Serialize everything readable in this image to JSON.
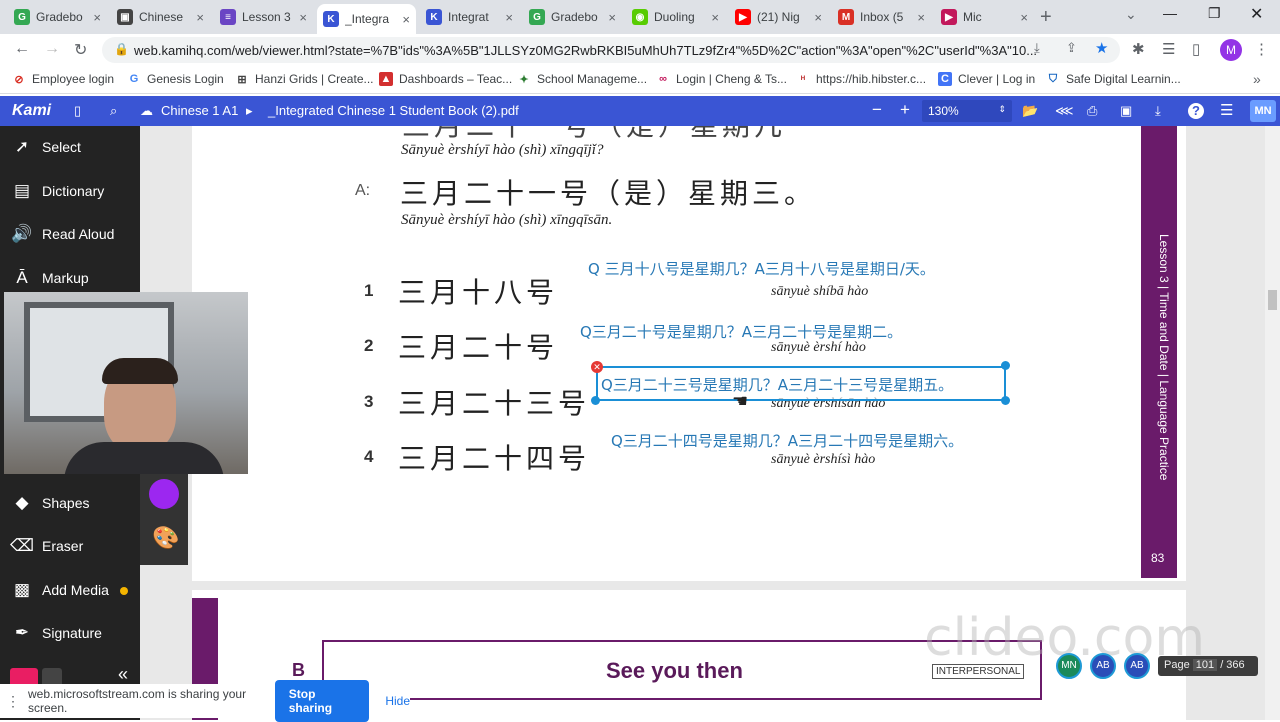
{
  "tabs": [
    {
      "label": "Gradebo",
      "fav": "G",
      "color": "#34a853"
    },
    {
      "label": "Chinese",
      "fav": "▣",
      "color": "#444"
    },
    {
      "label": "Lesson 3",
      "fav": "≡",
      "color": "#6a45c4"
    },
    {
      "label": "_Integra",
      "fav": "K",
      "color": "#3a55d4"
    },
    {
      "label": "Integrat",
      "fav": "K",
      "color": "#3a55d4"
    },
    {
      "label": "Gradebo",
      "fav": "G",
      "color": "#34a853"
    },
    {
      "label": "Duoling",
      "fav": "◉",
      "color": "#58cc02"
    },
    {
      "label": "(21) Nig",
      "fav": "▶",
      "color": "#ff0000"
    },
    {
      "label": "Inbox (5",
      "fav": "M",
      "color": "#d93025"
    },
    {
      "label": "Mic",
      "fav": "▶",
      "color": "#c2185b"
    }
  ],
  "url": "web.kamihq.com/web/viewer.html?state=%7B\"ids\"%3A%5B\"1JLLSYz0MG2RwbRKBI5uMhUh7TLz9fZr4\"%5D%2C\"action\"%3A\"open\"%2C\"userId\"%3A\"10...",
  "profile_initial": "M",
  "bookmarks": [
    "Employee login",
    "Genesis Login",
    "Hanzi Grids | Create...",
    "Dashboards – Teac...",
    "School Manageme...",
    "Login | Cheng & Ts...",
    "https://hib.hibster.c...",
    "Clever | Log in",
    "Safe Digital Learnin..."
  ],
  "kami": {
    "logo": "Kami",
    "breadcrumb_folder": "Chinese 1 A1",
    "filename": "_Integrated Chinese 1 Student Book (2).pdf",
    "zoom": "130%",
    "user_initials": "MN"
  },
  "sidebar": {
    "items": [
      "Select",
      "Dictionary",
      "Read Aloud",
      "Markup",
      "Shapes",
      "Eraser",
      "Add Media",
      "Signature"
    ]
  },
  "page": {
    "top_pinyin": "Sānyuè èrshíyī hào (shì) xīngqījǐ?",
    "a_label": "A:",
    "a_hanzi": "三月二十一号（是）星期三。",
    "a_pinyin": "Sānyuè èrshíyī hào (shì) xīngqīsān.",
    "items": [
      {
        "num": "1",
        "hanzi": "三月十八号",
        "pinyin": "sānyuè shíbā hào",
        "answer": "Q 三月十八号是星期几？A三月十八号是星期日/天。"
      },
      {
        "num": "2",
        "hanzi": "三月二十号",
        "pinyin": "sānyuè èrshí hào",
        "answer": "Q三月二十号是星期几？A三月二十号是星期二。"
      },
      {
        "num": "3",
        "hanzi": "三月二十三号",
        "pinyin": "sānyuè èrshísān hào",
        "answer": "Q三月二十三号是星期几？A三月二十三号是星期五。"
      },
      {
        "num": "4",
        "hanzi": "三月二十四号",
        "pinyin": "sānyuè èrshísì hào",
        "answer": "Q三月二十四号是星期几？A三月二十四号是星期六。"
      }
    ],
    "side_text": "Lesson 3 | Time and Date | Language Practice",
    "page_number": "83",
    "next_letter": "B",
    "next_title": "See you then",
    "next_tag": "INTERPERSONAL"
  },
  "page_counter": {
    "label": "Page",
    "current": "101",
    "total": "/ 366"
  },
  "avatars": [
    "MN",
    "AB",
    "AB"
  ],
  "watermark": "clideo.com",
  "share": {
    "text": "web.microsoftstream.com is sharing your screen.",
    "stop": "Stop sharing",
    "hide": "Hide"
  }
}
